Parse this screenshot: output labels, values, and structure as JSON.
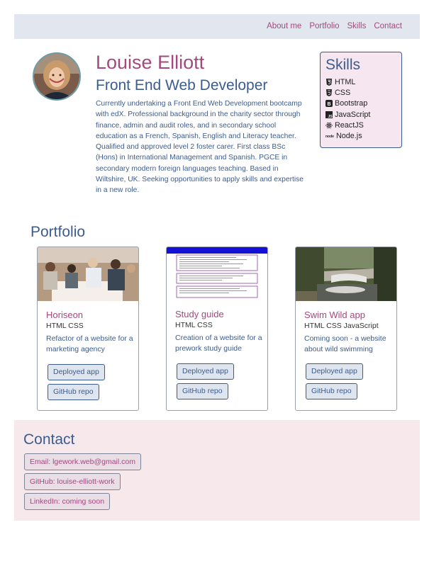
{
  "nav": {
    "links": [
      "About me",
      "Portfolio",
      "Skills",
      "Contact"
    ]
  },
  "about": {
    "name": "Louise Elliott",
    "role": "Front End Web Developer",
    "bio": "Currently undertaking a Front End Web Development bootcamp with edX. Professional background in the charity sector through finance, admin and audit roles, and in secondary school education as a French, Spanish, English and Literacy teacher. Qualified and approved level 2 foster carer. First class BSc (Hons) in International Management and Spanish. PGCE in secondary modern foreign languages teaching. Based in Wiltshire, UK. Seeking opportunities to apply skills and expertise in a new role."
  },
  "skills": {
    "title": "Skills",
    "items": [
      {
        "label": "HTML",
        "icon": "html5-icon"
      },
      {
        "label": "CSS",
        "icon": "css3-icon"
      },
      {
        "label": "Bootstrap",
        "icon": "bootstrap-icon"
      },
      {
        "label": "JavaScript",
        "icon": "javascript-icon"
      },
      {
        "label": "ReactJS",
        "icon": "react-icon"
      },
      {
        "label": "Node.js",
        "icon": "nodejs-icon"
      }
    ]
  },
  "portfolio": {
    "title": "Portfolio",
    "projects": [
      {
        "title": "Horiseon",
        "tech": "HTML CSS",
        "description": "Refactor of a website for a marketing agency",
        "deployed_label": "Deployed app",
        "repo_label": "GitHub repo"
      },
      {
        "title": "Study guide",
        "tech": "HTML CSS",
        "description": "Creation of a website for a prework study guide",
        "deployed_label": "Deployed app",
        "repo_label": "GitHub repo"
      },
      {
        "title": "Swim Wild app",
        "tech": "HTML CSS JavaScript",
        "description": "Coming soon - a website about wild swimming",
        "deployed_label": "Deployed app",
        "repo_label": "GitHub repo"
      }
    ]
  },
  "contact": {
    "title": "Contact",
    "items": [
      "Email: lgework.web@gmail.com",
      "GitHub: louise-elliott-work",
      "LinkedIn: coming soon"
    ]
  },
  "colors": {
    "accent": "#a3497e",
    "primary": "#3c5c8d",
    "nav_bg": "#e2e6ef",
    "contact_bg": "#f7e8eb",
    "skills_bg": "#f5e6f0"
  }
}
